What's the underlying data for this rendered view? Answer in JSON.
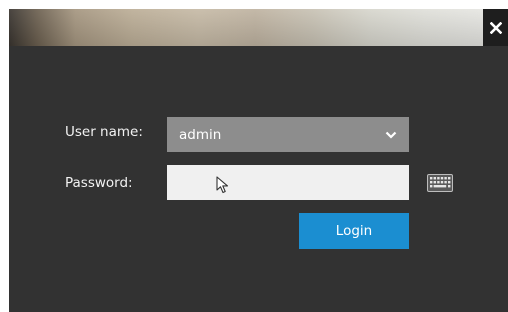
{
  "dialog": {
    "close_icon": "close-icon"
  },
  "form": {
    "username": {
      "label": "User name:",
      "value": "admin",
      "icon": "chevron-down-icon"
    },
    "password": {
      "label": "Password:",
      "value": "",
      "keyboard_icon": "keyboard-icon"
    },
    "login_label": "Login"
  },
  "colors": {
    "background": "#323232",
    "select": "#8d8d8d",
    "input": "#f0f0f0",
    "login": "#1b8ed1"
  }
}
